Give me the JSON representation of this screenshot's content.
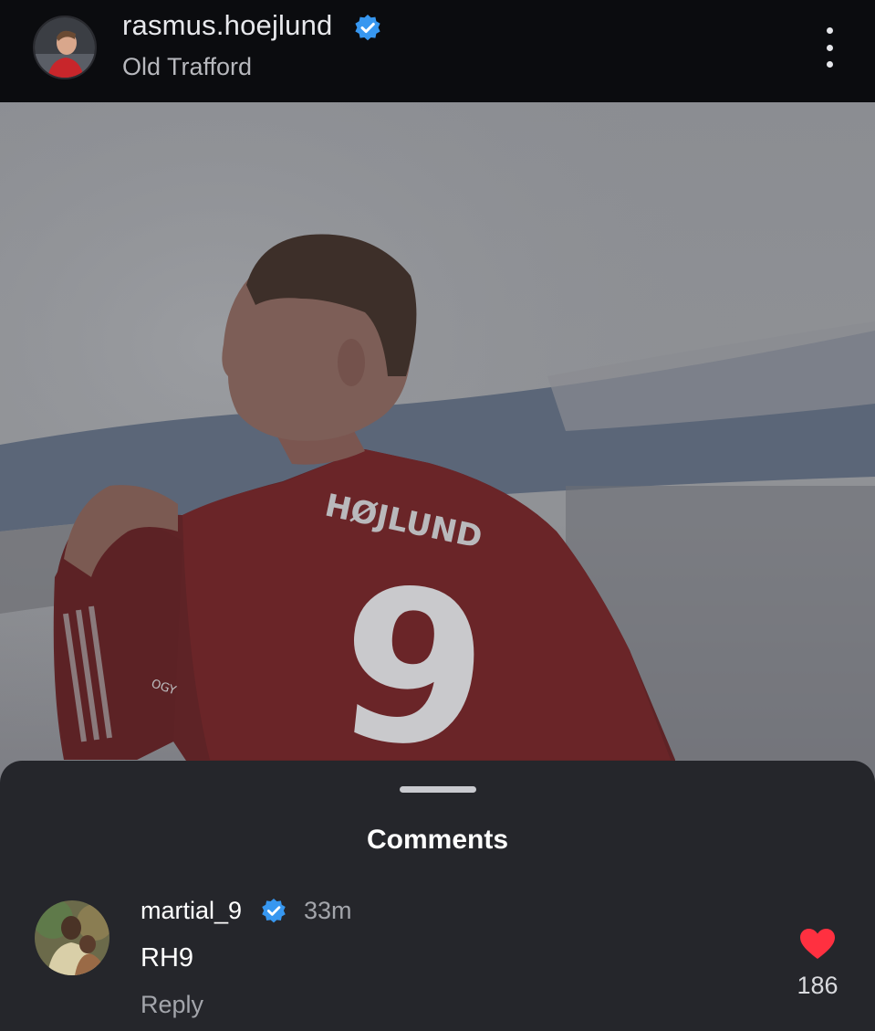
{
  "post": {
    "username": "rasmus.hoejlund",
    "location": "Old Trafford",
    "verified_icon": "verified-badge-icon",
    "more_icon": "more-vertical-icon",
    "image": {
      "jersey_name": "HØJLUND",
      "jersey_number": "9",
      "sleeve_text": "OGY"
    }
  },
  "comments_sheet": {
    "title": "Comments",
    "comments": [
      {
        "username": "martial_9",
        "verified": true,
        "time": "33m",
        "text": "RH9",
        "reply_label": "Reply",
        "like_count": "186",
        "liked": true
      }
    ]
  },
  "colors": {
    "header_bg": "#0b0c0f",
    "sheet_bg": "#25262b",
    "verified_blue": "#3797f0",
    "like_red": "#ff3040",
    "jersey_red": "#c8262b"
  }
}
